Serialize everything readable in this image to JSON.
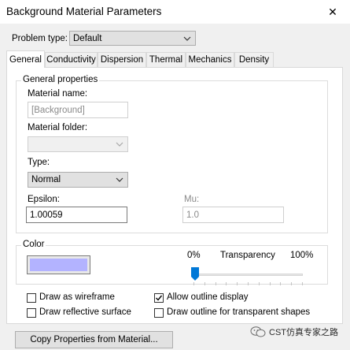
{
  "window": {
    "title": "Background Material Parameters",
    "close_glyph": "✕"
  },
  "problem_type": {
    "label": "Problem type:",
    "value": "Default"
  },
  "tabs": [
    "General",
    "Conductivity",
    "Dispersion",
    "Thermal",
    "Mechanics",
    "Density"
  ],
  "general": {
    "group_title": "General properties",
    "material_name_label": "Material name:",
    "material_name_value": "[Background]",
    "material_folder_label": "Material folder:",
    "material_folder_value": "",
    "type_label": "Type:",
    "type_value": "Normal",
    "epsilon_label": "Epsilon:",
    "epsilon_value": "1.00059",
    "mu_label": "Mu:",
    "mu_value": "1.0"
  },
  "color": {
    "group_title": "Color",
    "swatch": "#b3b3ff",
    "transparency_min": "0%",
    "transparency_label": "Transparency",
    "transparency_max": "100%",
    "transparency_value": 0
  },
  "options": [
    {
      "label": "Draw as wireframe",
      "checked": false
    },
    {
      "label": "Allow outline display",
      "checked": true
    },
    {
      "label": "Draw reflective surface",
      "checked": false
    },
    {
      "label": "Draw outline for transparent shapes",
      "checked": false
    }
  ],
  "copy_button": "Copy Properties from Material...",
  "watermark": "CST仿真专家之路",
  "accent": "#0078d7"
}
